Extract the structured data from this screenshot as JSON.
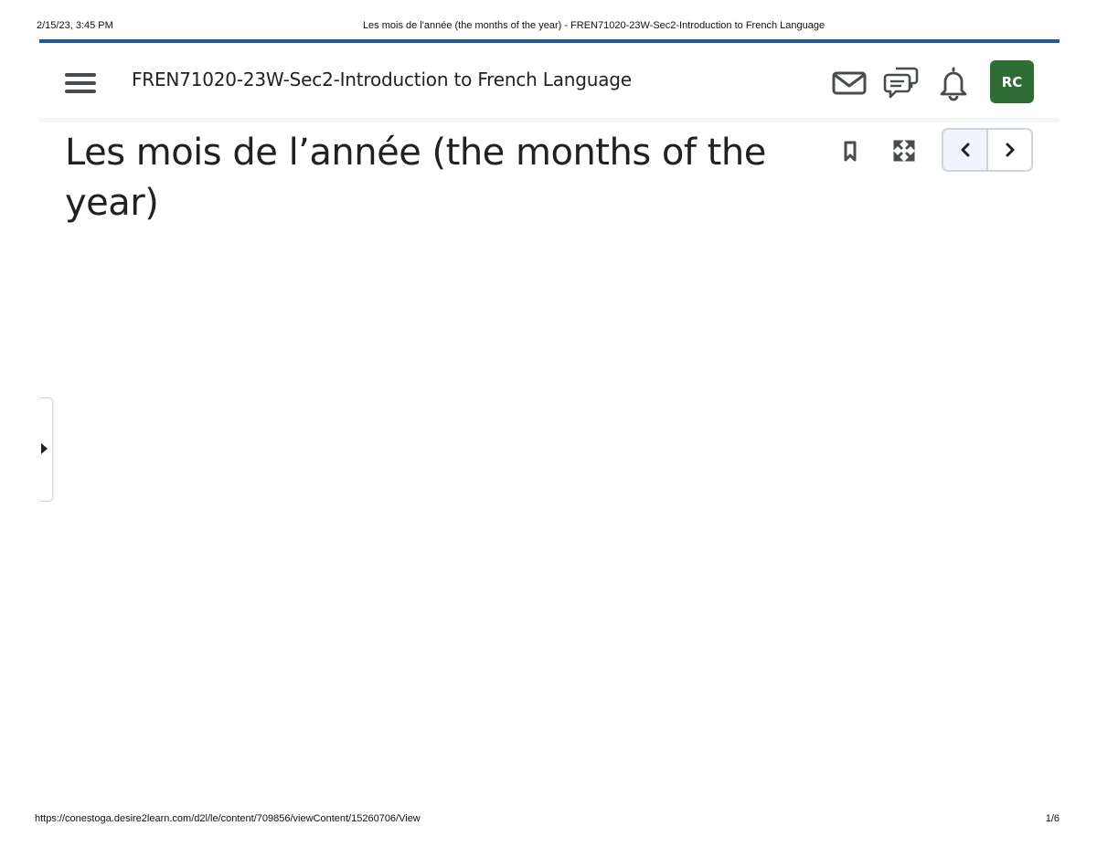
{
  "print_header": {
    "datetime": "2/15/23, 3:45 PM",
    "title": "Les mois de l'année (the months of the year) - FREN71020-23W-Sec2-Introduction to French Language"
  },
  "navbar": {
    "course_title": "FREN71020-23W-Sec2-Introduction to French Language",
    "icons": [
      "menu-icon",
      "mail-icon",
      "chat-icon",
      "bell-icon"
    ],
    "avatar_initials": "RC",
    "avatar_color": "#2f6d36",
    "accent_color": "#1f5b9a"
  },
  "content": {
    "topic_title": "Les mois de l’année (the months of the year)",
    "tools": [
      "bookmark-icon",
      "fullscreen-icon",
      "previous-icon",
      "next-icon"
    ]
  },
  "print_footer": {
    "url": "https://conestoga.desire2learn.com/d2l/le/content/709856/viewContent/15260706/View",
    "page": "1/6"
  }
}
